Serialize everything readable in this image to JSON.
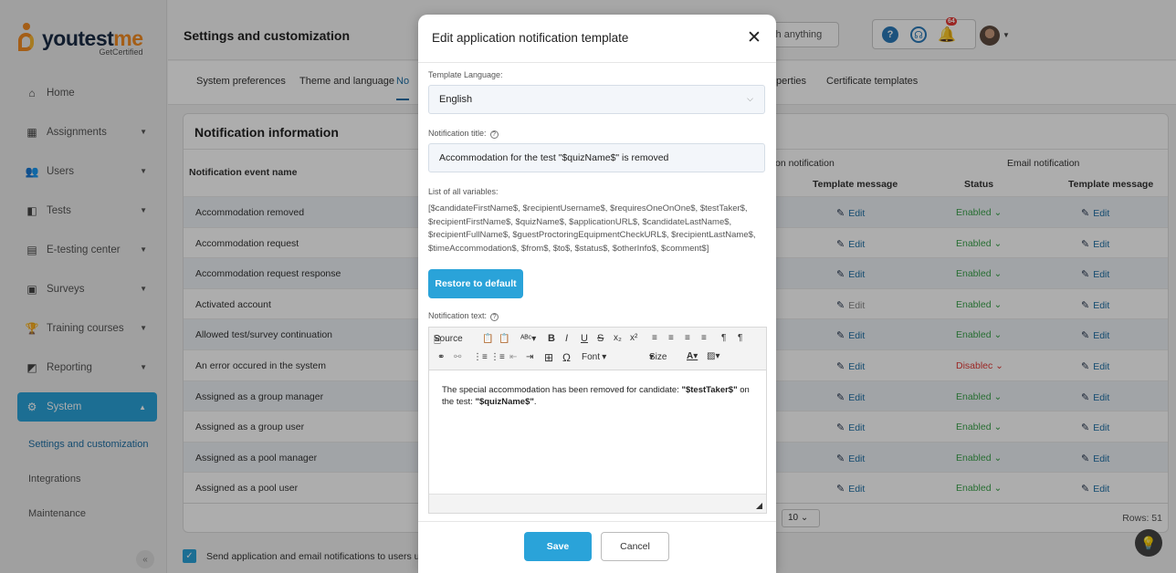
{
  "app": {
    "logo_you": "youtest",
    "logo_me": "me",
    "logo_sub": "GetCertified"
  },
  "sidebar": {
    "items": [
      {
        "label": "Home",
        "icon": "home-icon"
      },
      {
        "label": "Assignments",
        "icon": "assignments-icon"
      },
      {
        "label": "Users",
        "icon": "users-icon"
      },
      {
        "label": "Tests",
        "icon": "tests-icon"
      },
      {
        "label": "E-testing center",
        "icon": "etesting-icon"
      },
      {
        "label": "Surveys",
        "icon": "surveys-icon"
      },
      {
        "label": "Training courses",
        "icon": "trophy-icon"
      },
      {
        "label": "Reporting",
        "icon": "reporting-icon"
      },
      {
        "label": "System",
        "icon": "gear-icon"
      }
    ],
    "sub": [
      "Settings and customization",
      "Integrations",
      "Maintenance"
    ],
    "collapse": "«"
  },
  "header": {
    "title": "Settings and customization",
    "search_placeholder": "Search anything",
    "badge": "64"
  },
  "tabs": [
    "System preferences",
    "Theme and language",
    "No",
    "perties",
    "Certificate templates"
  ],
  "panel": {
    "title": "Notification information",
    "col_event": "Notification event name",
    "col_app_group": "on notification",
    "col_email_group": "Email notification",
    "col_template": "Template message",
    "col_status": "Status",
    "col_template2": "Template message",
    "edit_label": "Edit",
    "rows": [
      {
        "name": "Accommodation removed",
        "status": "Enabled ⌄"
      },
      {
        "name": "Accommodation request",
        "status": "Enabled ⌄"
      },
      {
        "name": "Accommodation request response",
        "status": "Enabled ⌄"
      },
      {
        "name": "Activated account",
        "status": "Enabled ⌄"
      },
      {
        "name": "Allowed test/survey continuation",
        "status": "Enabled ⌄"
      },
      {
        "name": "An error occured in the system",
        "status": "Disablec ⌄"
      },
      {
        "name": "Assigned as a group manager",
        "status": "Enabled ⌄"
      },
      {
        "name": "Assigned as a group user",
        "status": "Enabled ⌄"
      },
      {
        "name": "Assigned as a pool manager",
        "status": "Enabled ⌄"
      },
      {
        "name": "Assigned as a pool user",
        "status": "Enabled ⌄"
      }
    ],
    "page_size": "10 ⌄",
    "rows_count": "Rows: 51"
  },
  "send_notifications_label": "Send application and email notifications to users upon",
  "modal": {
    "title": "Edit application notification template",
    "language_label": "Template Language:",
    "language_value": "English",
    "title_label": "Notification title:",
    "title_value": "Accommodation for the test \"$quizName$\" is removed",
    "vars_label": "List of all variables:",
    "vars_text": "[$candidateFirstName$, $recipientUsername$, $requiresOneOnOne$, $testTaker$, $recipientFirstName$, $quizName$, $applicationURL$, $candidateLastName$, $recipientFullName$, $guestProctoringEquipmentCheckURL$, $recipientLastName$, $timeAccommodation$, $from$, $to$, $status$, $otherInfo$, $comment$]",
    "restore_label": "Restore to default",
    "text_label": "Notification text:",
    "toolbar": {
      "source": "Source",
      "font": "Font",
      "size": "Size"
    },
    "content_pre": "The special accommodation has been removed for candidate: ",
    "content_tt": "\"$testTaker$\"",
    "content_mid": " on the test: ",
    "content_qn": "\"$quizName$\"",
    "content_end": ".",
    "save_label": "Save",
    "cancel_label": "Cancel"
  },
  "colors": {
    "accent": "#2aa3d9",
    "link": "#1d6fa5",
    "enabled": "#3aa34a",
    "disabled": "#e53935"
  }
}
